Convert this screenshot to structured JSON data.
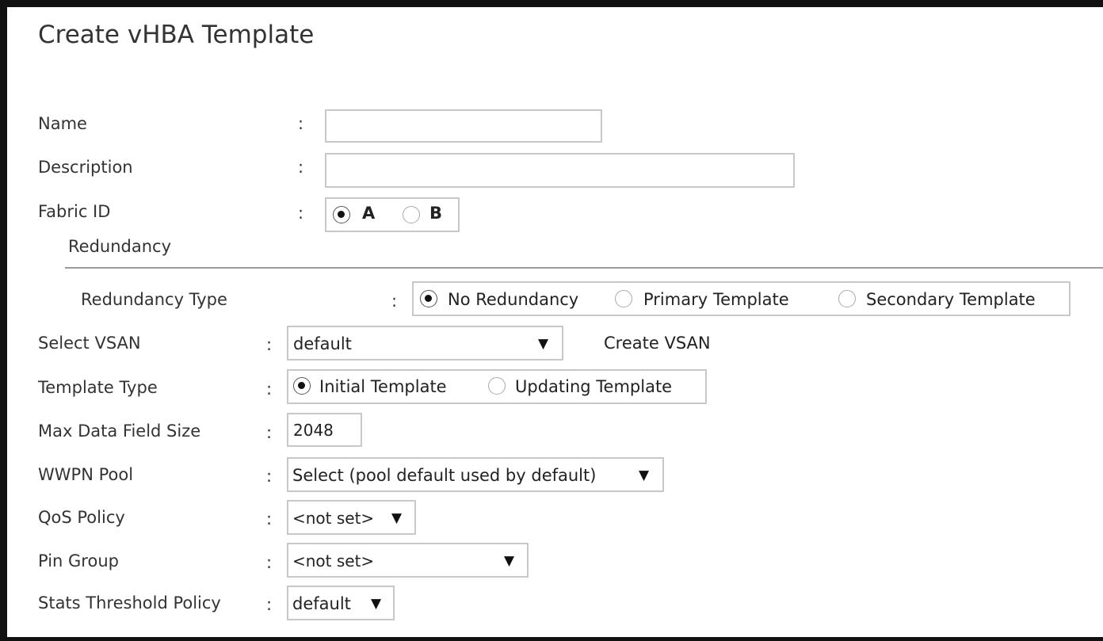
{
  "dialog": {
    "title": "Create vHBA Template"
  },
  "colon": ":",
  "form": {
    "name": {
      "label": "Name",
      "value": ""
    },
    "description": {
      "label": "Description",
      "value": ""
    },
    "fabric_id": {
      "label": "Fabric ID",
      "options": [
        "A",
        "B"
      ],
      "selected": "A"
    },
    "redundancy_section": "Redundancy",
    "redundancy_type": {
      "label": "Redundancy Type",
      "options": [
        "No Redundancy",
        "Primary Template",
        "Secondary Template"
      ],
      "selected": "No Redundancy"
    },
    "select_vsan": {
      "label": "Select VSAN",
      "value": "default",
      "create_link": "Create VSAN"
    },
    "template_type": {
      "label": "Template Type",
      "options": [
        "Initial Template",
        "Updating Template"
      ],
      "selected": "Initial Template"
    },
    "max_data_field_size": {
      "label": "Max Data Field Size",
      "value": "2048"
    },
    "wwpn_pool": {
      "label": "WWPN Pool",
      "value": "Select (pool default used by default)"
    },
    "qos_policy": {
      "label": "QoS Policy",
      "value": "<not set>"
    },
    "pin_group": {
      "label": "Pin Group",
      "value": "<not set>"
    },
    "stats_threshold_policy": {
      "label": "Stats Threshold Policy",
      "value": "default"
    }
  },
  "icons": {
    "dropdown_arrow": "▼"
  }
}
